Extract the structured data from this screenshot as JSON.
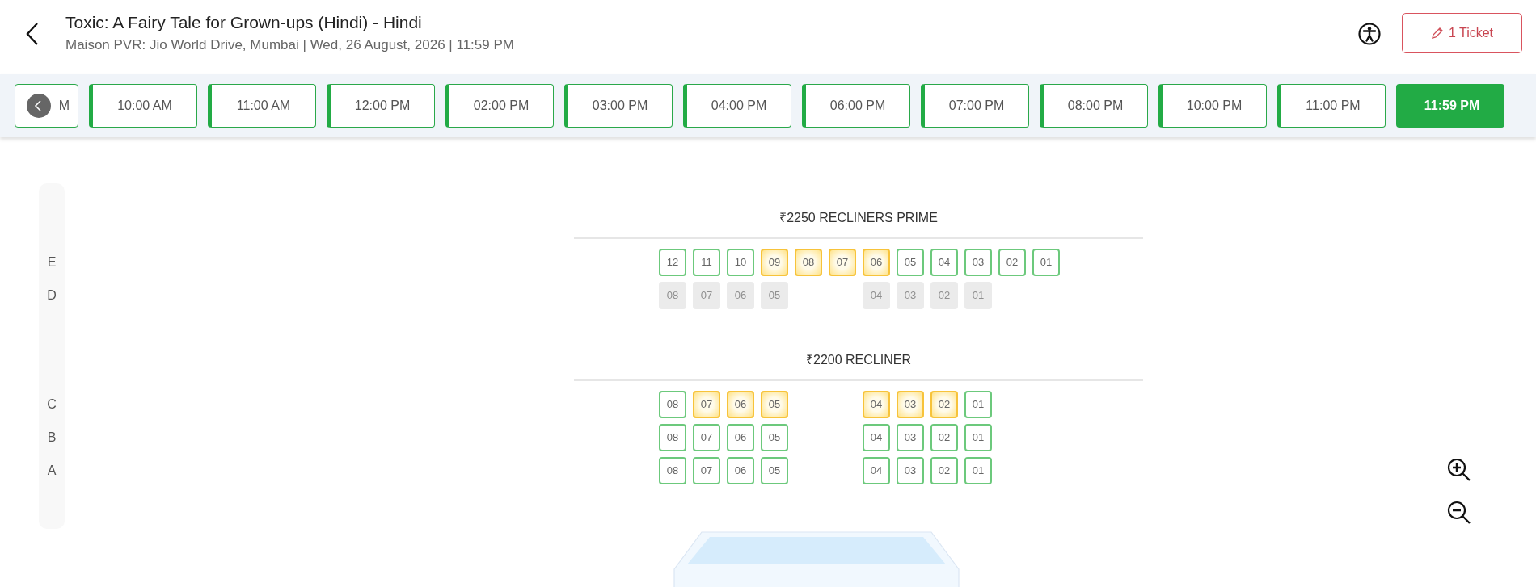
{
  "header": {
    "title": "Toxic: A Fairy Tale for Grown-ups (Hindi) - Hindi",
    "subtitle": "Maison PVR: Jio World Drive, Mumbai | Wed, 26 August, 2026 | 11:59 PM",
    "ticket_button": "1 Ticket"
  },
  "showtimes": [
    {
      "time": "M",
      "selected": false,
      "partial": true
    },
    {
      "time": "10:00 AM",
      "selected": false
    },
    {
      "time": "11:00 AM",
      "selected": false
    },
    {
      "time": "12:00 PM",
      "selected": false
    },
    {
      "time": "02:00 PM",
      "selected": false
    },
    {
      "time": "03:00 PM",
      "selected": false
    },
    {
      "time": "04:00 PM",
      "selected": false
    },
    {
      "time": "06:00 PM",
      "selected": false
    },
    {
      "time": "07:00 PM",
      "selected": false
    },
    {
      "time": "08:00 PM",
      "selected": false
    },
    {
      "time": "10:00 PM",
      "selected": false
    },
    {
      "time": "11:00 PM",
      "selected": false
    },
    {
      "time": "11:59 PM",
      "selected": true
    }
  ],
  "sections": [
    {
      "title": "₹2250 RECLINERS PRIME",
      "rows": [
        {
          "label": "E",
          "blocks": [
            [
              {
                "n": "12",
                "kind": "available"
              },
              {
                "n": "11",
                "kind": "available"
              },
              {
                "n": "10",
                "kind": "available"
              },
              {
                "n": "09",
                "kind": "highlighted"
              },
              {
                "n": "08",
                "kind": "highlighted"
              },
              {
                "n": "07",
                "kind": "highlighted"
              },
              {
                "n": "06",
                "kind": "highlighted"
              },
              {
                "n": "05",
                "kind": "available"
              },
              {
                "n": "04",
                "kind": "available"
              },
              {
                "n": "03",
                "kind": "available"
              },
              {
                "n": "02",
                "kind": "available"
              },
              {
                "n": "01",
                "kind": "available"
              }
            ]
          ]
        },
        {
          "label": "D",
          "blocks": [
            [
              {
                "n": "08",
                "kind": "sold"
              },
              {
                "n": "07",
                "kind": "sold"
              },
              {
                "n": "06",
                "kind": "sold"
              },
              {
                "n": "05",
                "kind": "sold"
              }
            ],
            [
              {
                "n": "04",
                "kind": "sold"
              },
              {
                "n": "03",
                "kind": "sold"
              },
              {
                "n": "02",
                "kind": "sold"
              },
              {
                "n": "01",
                "kind": "sold"
              }
            ]
          ]
        }
      ]
    },
    {
      "title": "₹2200 RECLINER",
      "rows": [
        {
          "label": "C",
          "blocks": [
            [
              {
                "n": "08",
                "kind": "available"
              },
              {
                "n": "07",
                "kind": "highlighted"
              },
              {
                "n": "06",
                "kind": "highlighted"
              },
              {
                "n": "05",
                "kind": "highlighted"
              }
            ],
            [
              {
                "n": "04",
                "kind": "highlighted"
              },
              {
                "n": "03",
                "kind": "highlighted"
              },
              {
                "n": "02",
                "kind": "highlighted"
              },
              {
                "n": "01",
                "kind": "available"
              }
            ]
          ]
        },
        {
          "label": "B",
          "blocks": [
            [
              {
                "n": "08",
                "kind": "available"
              },
              {
                "n": "07",
                "kind": "available"
              },
              {
                "n": "06",
                "kind": "available"
              },
              {
                "n": "05",
                "kind": "available"
              }
            ],
            [
              {
                "n": "04",
                "kind": "available"
              },
              {
                "n": "03",
                "kind": "available"
              },
              {
                "n": "02",
                "kind": "available"
              },
              {
                "n": "01",
                "kind": "available"
              }
            ]
          ]
        },
        {
          "label": "A",
          "blocks": [
            [
              {
                "n": "08",
                "kind": "available"
              },
              {
                "n": "07",
                "kind": "available"
              },
              {
                "n": "06",
                "kind": "available"
              },
              {
                "n": "05",
                "kind": "available"
              }
            ],
            [
              {
                "n": "04",
                "kind": "available"
              },
              {
                "n": "03",
                "kind": "available"
              },
              {
                "n": "02",
                "kind": "available"
              },
              {
                "n": "01",
                "kind": "available"
              }
            ]
          ]
        }
      ]
    }
  ]
}
